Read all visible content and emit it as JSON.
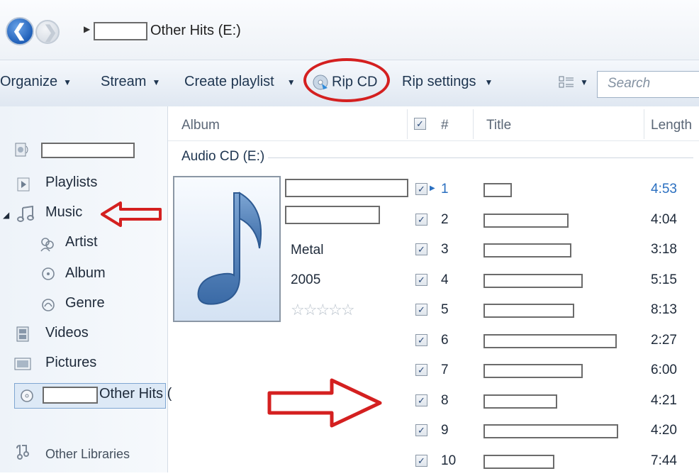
{
  "nav": {
    "breadcrumb_drive": "Other Hits (E:)"
  },
  "toolbar": {
    "organize": "Organize",
    "stream": "Stream",
    "create_playlist": "Create playlist",
    "rip_cd": "Rip CD",
    "rip_settings": "Rip settings",
    "search_placeholder": "Search"
  },
  "sidebar": {
    "playlists": "Playlists",
    "music": "Music",
    "artist": "Artist",
    "album": "Album",
    "genre": "Genre",
    "videos": "Videos",
    "pictures": "Pictures",
    "cd": "Other Hits (",
    "other_libraries": "Other Libraries"
  },
  "columns": {
    "album": "Album",
    "number": "#",
    "title": "Title",
    "length": "Length"
  },
  "group_label": "Audio CD (E:)",
  "album_info": {
    "genre": "Metal",
    "year": "2005",
    "rating_stars": 0
  },
  "tracks": [
    {
      "n": "1",
      "length": "4:53"
    },
    {
      "n": "2",
      "length": "4:04"
    },
    {
      "n": "3",
      "length": "3:18"
    },
    {
      "n": "4",
      "length": "5:15"
    },
    {
      "n": "5",
      "length": "8:13"
    },
    {
      "n": "6",
      "length": "2:27"
    },
    {
      "n": "7",
      "length": "6:00"
    },
    {
      "n": "8",
      "length": "4:21"
    },
    {
      "n": "9",
      "length": "4:20"
    },
    {
      "n": "10",
      "length": "7:44"
    }
  ],
  "colors": {
    "annotation_red": "#d42020",
    "selected_track": "#2a6fc0"
  }
}
